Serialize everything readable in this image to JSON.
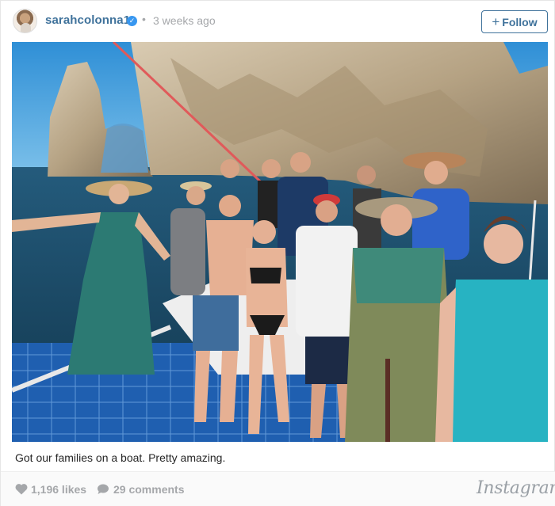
{
  "post": {
    "username": "sarahcolonna1",
    "verified_icon": "verified-badge-icon",
    "separator": "•",
    "timestamp": "3 weeks ago",
    "follow_label": "Follow",
    "follow_icon": "plus-icon",
    "caption": "Got our families on a boat. Pretty amazing.",
    "likes": "1,196 likes",
    "comments": "29 comments",
    "brand": "Instagram"
  },
  "colors": {
    "username": "#3f729b",
    "meta": "#a5a7aa",
    "verified": "#3897f0",
    "footer_bg": "#fafafa"
  }
}
